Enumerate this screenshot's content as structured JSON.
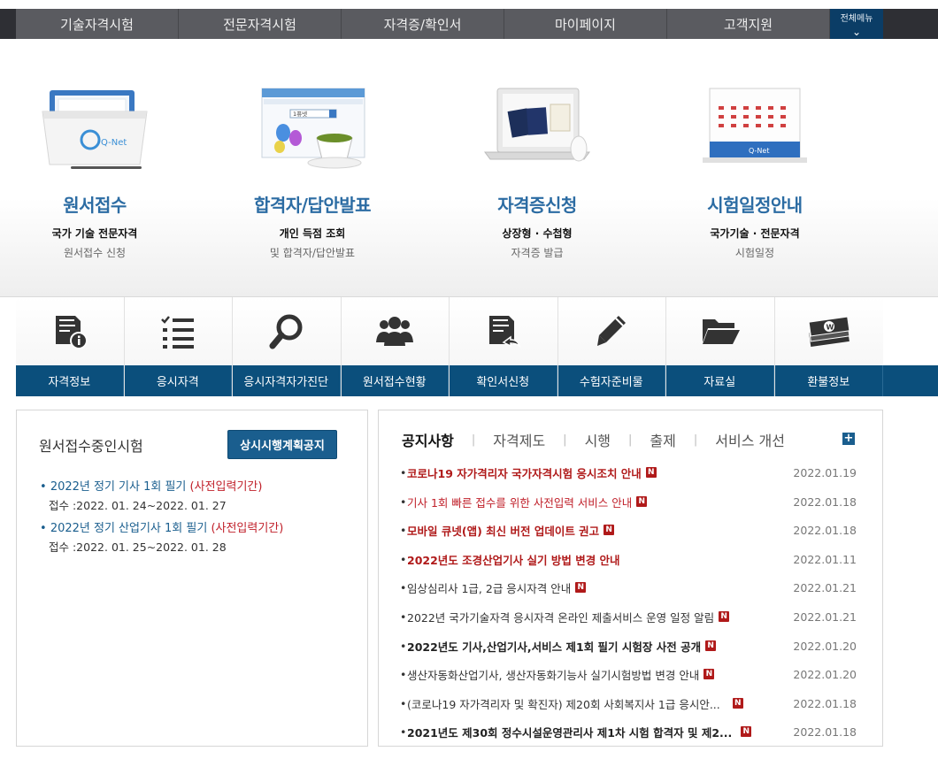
{
  "topnav": {
    "items": [
      "기술자격시험",
      "전문자격시험",
      "자격증/확인서",
      "마이페이지",
      "고객지원"
    ],
    "all_menu": "전체메뉴"
  },
  "hero": {
    "cards": [
      {
        "title": "원서접수",
        "line1": "국가 기술 전문자격",
        "line2": "원서접수 신청",
        "icon": "folder-icon",
        "logo": "Q-Net"
      },
      {
        "title": "합격자/답안발표",
        "line1": "개인 득점 조회",
        "line2": "및 합격자/답안발표",
        "icon": "browser-icon",
        "search_text": "1퓨넷"
      },
      {
        "title": "자격증신청",
        "line1": "상장형 · 수첩형",
        "line2": "자격증 발급",
        "icon": "laptop-icon"
      },
      {
        "title": "시험일정안내",
        "line1": "국가기술 · 전문자격",
        "line2": "시험일정",
        "icon": "calendar-icon",
        "logo": "Q-Net"
      }
    ]
  },
  "quick": {
    "items": [
      {
        "label": "자격정보",
        "icon": "document-info-icon"
      },
      {
        "label": "응시자격",
        "icon": "checklist-icon"
      },
      {
        "label": "응시자격자가진단",
        "icon": "magnifier-icon"
      },
      {
        "label": "원서접수현황",
        "icon": "people-icon"
      },
      {
        "label": "확인서신청",
        "icon": "document-reply-icon"
      },
      {
        "label": "수험자준비물",
        "icon": "pencil-icon"
      },
      {
        "label": "자료실",
        "icon": "folder-open-icon"
      },
      {
        "label": "환불정보",
        "icon": "money-icon"
      }
    ]
  },
  "left": {
    "heading": "원서접수중인시험",
    "button": "상시시행계획공지",
    "exams": [
      {
        "title": "2022년 정기 기사 1회 필기",
        "note": "(사전입력기간)",
        "date": "접수 :2022. 01. 24~2022. 01. 27"
      },
      {
        "title": "2022년 정기 산업기사 1회 필기",
        "note": "(사전입력기간)",
        "date": "접수 :2022. 01. 25~2022. 01. 28"
      }
    ]
  },
  "right": {
    "tabs": [
      "공지사항",
      "자격제도",
      "시행",
      "출제",
      "서비스 개선"
    ],
    "new_badge": "N",
    "notices": [
      {
        "title": "코로나19 자가격리자 국가자격시험 응시조치 안내",
        "date": "2022.01.19",
        "style": "redb"
      },
      {
        "title": "기사 1회 빠른 접수를 위한 사전입력 서비스 안내",
        "date": "2022.01.18",
        "style": "red"
      },
      {
        "title": "모바일 큐넷(앱) 최신 버전 업데이트 권고",
        "date": "2022.01.18",
        "style": "redb"
      },
      {
        "title": "2022년도 조경산업기사 실기 방법 변경 안내",
        "date": "2022.01.11",
        "style": "redb"
      },
      {
        "title": "임상심리사 1급, 2급 응시자격 안내",
        "date": "2022.01.21",
        "style": "dark"
      },
      {
        "title": "2022년 국가기술자격 응시자격 온라인 제출서비스 운영 일정 알림",
        "date": "2022.01.21",
        "style": "dark"
      },
      {
        "title": "2022년도 기사,산업기사,서비스 제1회 필기 시험장 사전 공개",
        "date": "2022.01.20",
        "style": "darkb"
      },
      {
        "title": "생산자동화산업기사, 생산자동화기능사 실기시험방법 변경 안내",
        "date": "2022.01.20",
        "style": "dark"
      },
      {
        "title": "(코로나19 자가격리자 및 확진자) 제20회 사회복지사 1급 응시안...",
        "date": "2022.01.18",
        "style": "dark"
      },
      {
        "title": "2021년도 제30회 정수시설운영관리사 제1차 시험 합격자 및 제2...",
        "date": "2022.01.18",
        "style": "darkb"
      }
    ]
  }
}
